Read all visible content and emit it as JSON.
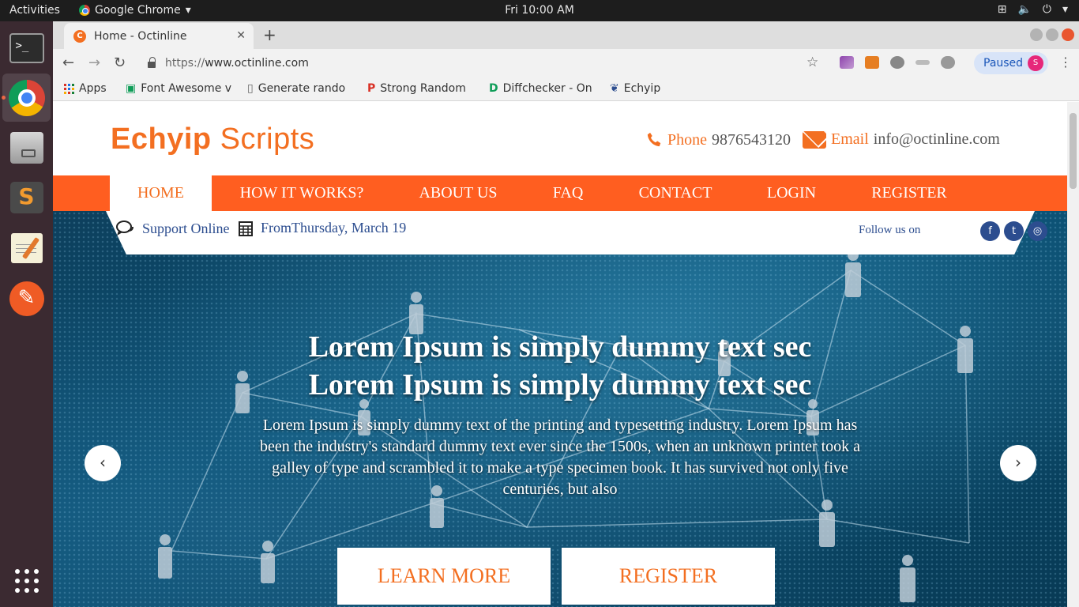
{
  "os": {
    "activities": "Activities",
    "app_menu": "Google Chrome",
    "app_menu_caret": "▾",
    "clock": "Fri 10:00 AM"
  },
  "browser": {
    "tab_title": "Home - Octinline",
    "tab_close": "✕",
    "new_tab": "+",
    "url_scheme": "https://",
    "url_host": "www.octinline.com",
    "profile_status": "Paused",
    "profile_initial": "S",
    "bookmarks": [
      {
        "label": "Apps"
      },
      {
        "label": "Font Awesome v"
      },
      {
        "label": "Generate rando"
      },
      {
        "label": "Strong Random"
      },
      {
        "label": "Diffchecker - On"
      },
      {
        "label": "Echyip"
      }
    ]
  },
  "site": {
    "logo_bold": "Echyip",
    "logo_light": " Scripts",
    "phone_label": "Phone",
    "phone_value": "9876543120",
    "email_label": "Email",
    "email_value": "info@octinline.com",
    "nav": [
      "HOME",
      "HOW IT WORKS?",
      "ABOUT US",
      "FAQ",
      "CONTACT",
      "LOGIN",
      "REGISTER"
    ],
    "nav_active": "HOME",
    "support": "Support Online",
    "date": "FromThursday, March 19",
    "follow": "Follow us on",
    "social": [
      "f",
      "t",
      "◎"
    ],
    "hero_title_1": "Lorem Ipsum is simply dummy text sec",
    "hero_title_2": "Lorem Ipsum is simply dummy text sec",
    "hero_text": "Lorem Ipsum is simply dummy text of the printing and typesetting industry. Lorem Ipsum has been the industry's standard dummy text ever since the 1500s, when an unknown printer took a galley of type and scrambled it to make a type specimen book. It has survived not only five centuries, but also",
    "prev_arrow": "‹",
    "next_arrow": "›",
    "learn_more": "LEARN MORE",
    "register_btn": "REGISTER"
  },
  "colors": {
    "brand_orange": "#f36f21",
    "nav_orange": "#ff5e20",
    "link_blue": "#2c4d8f"
  }
}
